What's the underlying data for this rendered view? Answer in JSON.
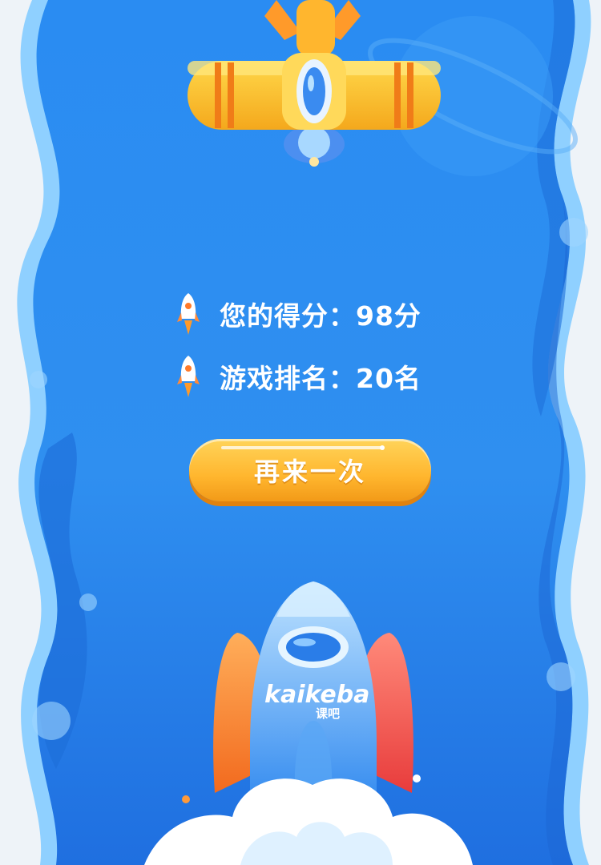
{
  "score": {
    "text": "您的得分：98分"
  },
  "rank": {
    "text": "游戏排名：20名"
  },
  "retry_button": {
    "label": "再来一次"
  },
  "brand": {
    "logo_text": "kaikeba",
    "logo_subtext": "课吧"
  },
  "colors": {
    "background_blue": "#2b8ef0",
    "button_orange": "#ffb62e",
    "plane_yellow": "#ffc52a"
  }
}
